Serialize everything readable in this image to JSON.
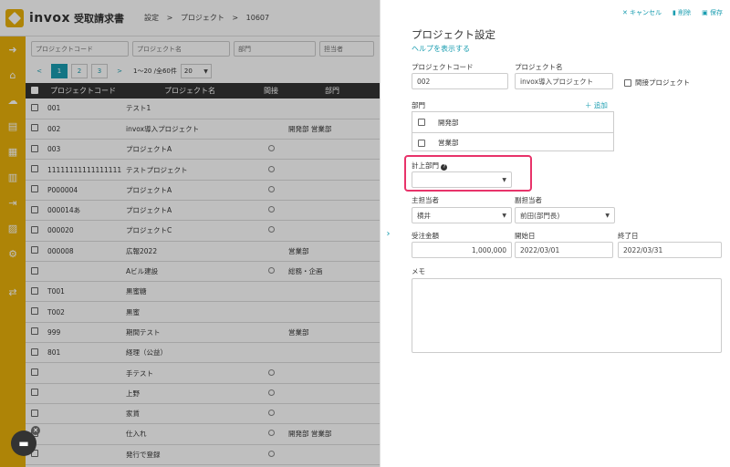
{
  "header": {
    "logo_text": "invox",
    "logo_sub": "受取請求書",
    "breadcrumb": [
      "設定",
      ">",
      "プロジェクト",
      ">",
      "10607"
    ]
  },
  "sidebar": {
    "icons": [
      "arrow-right-circle-icon",
      "home-icon",
      "cloud-upload-icon",
      "document-icon",
      "document-check-icon",
      "building-icon",
      "export-icon",
      "chart-icon",
      "gear-icon",
      "exchange-icon"
    ]
  },
  "filters": {
    "code_placeholder": "プロジェクトコード",
    "name_placeholder": "プロジェクト名",
    "dept_placeholder": "部門",
    "person_placeholder": "担当者"
  },
  "pager": {
    "pages": [
      "1",
      "2",
      "3"
    ],
    "next": ">",
    "prev": "<",
    "info": "1〜20 /全60件",
    "per_page": "20"
  },
  "table": {
    "headers": [
      "プロジェクトコード",
      "プロジェクト名",
      "間接",
      "部門"
    ],
    "rows": [
      {
        "code": "001",
        "name": "テスト1",
        "indirect": false,
        "dept": ""
      },
      {
        "code": "002",
        "name": "invox導入プロジェクト",
        "indirect": false,
        "dept": "開発部 営業部"
      },
      {
        "code": "003",
        "name": "プロジェクトA",
        "indirect": true,
        "dept": ""
      },
      {
        "code": "11111111111111111111",
        "name": "テストプロジェクト",
        "indirect": true,
        "dept": ""
      },
      {
        "code": "P000004",
        "name": "プロジェクトA",
        "indirect": true,
        "dept": ""
      },
      {
        "code": "000014あ",
        "name": "プロジェクトA",
        "indirect": true,
        "dept": ""
      },
      {
        "code": "000020",
        "name": "プロジェクトC",
        "indirect": true,
        "dept": ""
      },
      {
        "code": "000008",
        "name": "広報2022",
        "indirect": false,
        "dept": "営業部"
      },
      {
        "code": "",
        "name": "Aビル建設",
        "indirect": true,
        "dept": "総務・企画"
      },
      {
        "code": "T001",
        "name": "黒蜜糖",
        "indirect": false,
        "dept": ""
      },
      {
        "code": "T002",
        "name": "黒蜜",
        "indirect": false,
        "dept": ""
      },
      {
        "code": "999",
        "name": "期間テスト",
        "indirect": false,
        "dept": "営業部"
      },
      {
        "code": "801",
        "name": "経理（公益）",
        "indirect": false,
        "dept": ""
      },
      {
        "code": "",
        "name": "手テスト",
        "indirect": true,
        "dept": ""
      },
      {
        "code": "",
        "name": "上野",
        "indirect": true,
        "dept": ""
      },
      {
        "code": "",
        "name": "家賃",
        "indirect": true,
        "dept": ""
      },
      {
        "code": "",
        "name": "仕入れ",
        "indirect": true,
        "dept": "開発部 営業部"
      },
      {
        "code": "",
        "name": "発行で登録",
        "indirect": true,
        "dept": ""
      }
    ]
  },
  "panel": {
    "actions": {
      "cancel": "✕ キャンセル",
      "delete": "削除",
      "save": "保存"
    },
    "title": "プロジェクト設定",
    "help": "ヘルプを表示する",
    "code_label": "プロジェクトコード",
    "code_value": "002",
    "name_label": "プロジェクト名",
    "name_value": "invox導入プロジェクト",
    "indirect_label": "間接プロジェクト",
    "dept_label": "部門",
    "add_label": "＋ 追加",
    "depts": [
      "開発部",
      "営業部"
    ],
    "booking_dept_label": "計上部門",
    "booking_dept_value": "",
    "main_person_label": "主担当者",
    "main_person_value": "横井",
    "sub_person_label": "副担当者",
    "sub_person_value": "前田(部門長)",
    "amount_label": "受注金額",
    "amount_value": "1,000,000",
    "start_label": "開始日",
    "start_value": "2022/03/01",
    "end_label": "終了日",
    "end_value": "2022/03/31",
    "memo_label": "メモ"
  }
}
